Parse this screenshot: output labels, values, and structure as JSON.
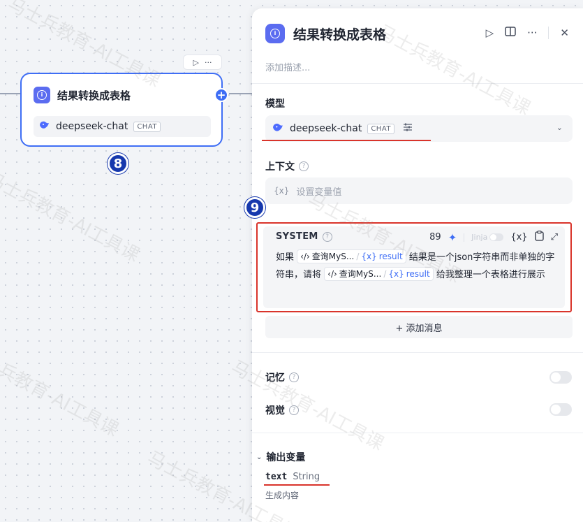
{
  "canvas": {
    "node_tools": {
      "run_icon": "▷",
      "more_icon": "···"
    },
    "node": {
      "title": "结果转换成表格",
      "model": "deepseek-chat",
      "model_tag": "CHAT"
    },
    "step_badge_node": "8",
    "step_badge_system": "9"
  },
  "panel": {
    "title": "结果转换成表格",
    "description_placeholder": "添加描述...",
    "model_section": {
      "label": "模型",
      "model_name": "deepseek-chat",
      "model_tag": "CHAT"
    },
    "context_section": {
      "label": "上下文",
      "var_icon": "{x}",
      "placeholder": "设置变量值"
    },
    "system_prompt": {
      "label": "SYSTEM",
      "word_count": "89",
      "jinja_label": "Jinja",
      "var_icon": "{x}",
      "text_part1": "如果",
      "ref1_name": "查询MyS...",
      "ref1_var": "result",
      "text_part2": "结果是一个json字符串而非单独的字符串，请将",
      "ref2_name": "查询MyS...",
      "ref2_var": "result",
      "text_part3": "给我整理一个表格进行展示"
    },
    "add_message": "+ 添加消息",
    "memory": {
      "label": "记忆"
    },
    "vision": {
      "label": "视觉"
    },
    "output": {
      "label": "输出变量",
      "var_name": "text",
      "var_type": "String",
      "var_desc": "生成内容"
    }
  },
  "watermark": {
    "text": "马士兵教育-AI工具课"
  },
  "colors": {
    "accent": "#3f6ef5",
    "highlight": "#d9342b",
    "badge": "#1638ad"
  }
}
